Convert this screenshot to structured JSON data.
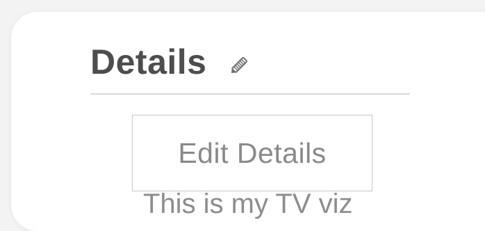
{
  "details": {
    "title": "Details",
    "edit_icon": "pencil-icon",
    "tooltip_text": "Edit Details",
    "description": "This is my TV viz"
  },
  "colors": {
    "title": "#4d4d4d",
    "muted_text": "#8a8a8a",
    "divider": "#d9d9d9",
    "card": "#ffffff",
    "background": "#f3f3f3"
  }
}
